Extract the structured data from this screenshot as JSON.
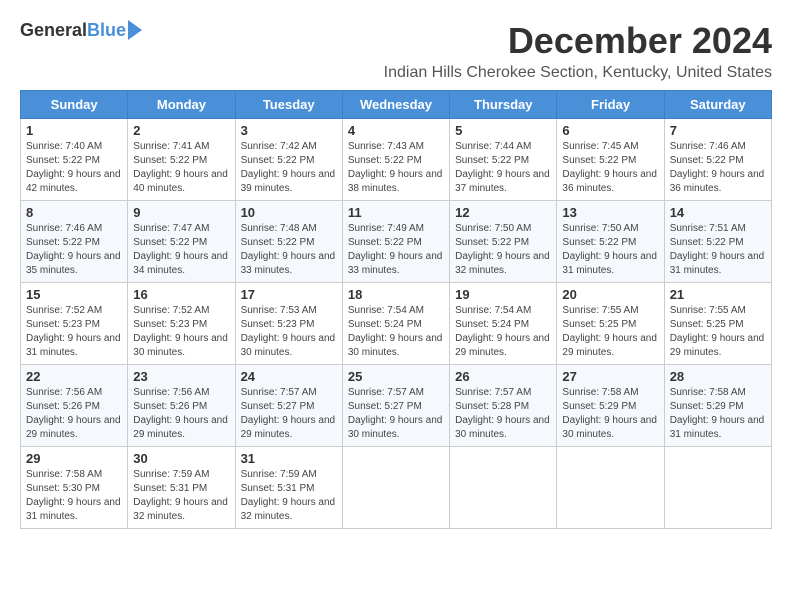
{
  "logo": {
    "general": "General",
    "blue": "Blue"
  },
  "title": "December 2024",
  "location": "Indian Hills Cherokee Section, Kentucky, United States",
  "headers": [
    "Sunday",
    "Monday",
    "Tuesday",
    "Wednesday",
    "Thursday",
    "Friday",
    "Saturday"
  ],
  "weeks": [
    [
      {
        "day": "1",
        "sunrise": "7:40 AM",
        "sunset": "5:22 PM",
        "daylight": "9 hours and 42 minutes."
      },
      {
        "day": "2",
        "sunrise": "7:41 AM",
        "sunset": "5:22 PM",
        "daylight": "9 hours and 40 minutes."
      },
      {
        "day": "3",
        "sunrise": "7:42 AM",
        "sunset": "5:22 PM",
        "daylight": "9 hours and 39 minutes."
      },
      {
        "day": "4",
        "sunrise": "7:43 AM",
        "sunset": "5:22 PM",
        "daylight": "9 hours and 38 minutes."
      },
      {
        "day": "5",
        "sunrise": "7:44 AM",
        "sunset": "5:22 PM",
        "daylight": "9 hours and 37 minutes."
      },
      {
        "day": "6",
        "sunrise": "7:45 AM",
        "sunset": "5:22 PM",
        "daylight": "9 hours and 36 minutes."
      },
      {
        "day": "7",
        "sunrise": "7:46 AM",
        "sunset": "5:22 PM",
        "daylight": "9 hours and 36 minutes."
      }
    ],
    [
      {
        "day": "8",
        "sunrise": "7:46 AM",
        "sunset": "5:22 PM",
        "daylight": "9 hours and 35 minutes."
      },
      {
        "day": "9",
        "sunrise": "7:47 AM",
        "sunset": "5:22 PM",
        "daylight": "9 hours and 34 minutes."
      },
      {
        "day": "10",
        "sunrise": "7:48 AM",
        "sunset": "5:22 PM",
        "daylight": "9 hours and 33 minutes."
      },
      {
        "day": "11",
        "sunrise": "7:49 AM",
        "sunset": "5:22 PM",
        "daylight": "9 hours and 33 minutes."
      },
      {
        "day": "12",
        "sunrise": "7:50 AM",
        "sunset": "5:22 PM",
        "daylight": "9 hours and 32 minutes."
      },
      {
        "day": "13",
        "sunrise": "7:50 AM",
        "sunset": "5:22 PM",
        "daylight": "9 hours and 31 minutes."
      },
      {
        "day": "14",
        "sunrise": "7:51 AM",
        "sunset": "5:22 PM",
        "daylight": "9 hours and 31 minutes."
      }
    ],
    [
      {
        "day": "15",
        "sunrise": "7:52 AM",
        "sunset": "5:23 PM",
        "daylight": "9 hours and 31 minutes."
      },
      {
        "day": "16",
        "sunrise": "7:52 AM",
        "sunset": "5:23 PM",
        "daylight": "9 hours and 30 minutes."
      },
      {
        "day": "17",
        "sunrise": "7:53 AM",
        "sunset": "5:23 PM",
        "daylight": "9 hours and 30 minutes."
      },
      {
        "day": "18",
        "sunrise": "7:54 AM",
        "sunset": "5:24 PM",
        "daylight": "9 hours and 30 minutes."
      },
      {
        "day": "19",
        "sunrise": "7:54 AM",
        "sunset": "5:24 PM",
        "daylight": "9 hours and 29 minutes."
      },
      {
        "day": "20",
        "sunrise": "7:55 AM",
        "sunset": "5:25 PM",
        "daylight": "9 hours and 29 minutes."
      },
      {
        "day": "21",
        "sunrise": "7:55 AM",
        "sunset": "5:25 PM",
        "daylight": "9 hours and 29 minutes."
      }
    ],
    [
      {
        "day": "22",
        "sunrise": "7:56 AM",
        "sunset": "5:26 PM",
        "daylight": "9 hours and 29 minutes."
      },
      {
        "day": "23",
        "sunrise": "7:56 AM",
        "sunset": "5:26 PM",
        "daylight": "9 hours and 29 minutes."
      },
      {
        "day": "24",
        "sunrise": "7:57 AM",
        "sunset": "5:27 PM",
        "daylight": "9 hours and 29 minutes."
      },
      {
        "day": "25",
        "sunrise": "7:57 AM",
        "sunset": "5:27 PM",
        "daylight": "9 hours and 30 minutes."
      },
      {
        "day": "26",
        "sunrise": "7:57 AM",
        "sunset": "5:28 PM",
        "daylight": "9 hours and 30 minutes."
      },
      {
        "day": "27",
        "sunrise": "7:58 AM",
        "sunset": "5:29 PM",
        "daylight": "9 hours and 30 minutes."
      },
      {
        "day": "28",
        "sunrise": "7:58 AM",
        "sunset": "5:29 PM",
        "daylight": "9 hours and 31 minutes."
      }
    ],
    [
      {
        "day": "29",
        "sunrise": "7:58 AM",
        "sunset": "5:30 PM",
        "daylight": "9 hours and 31 minutes."
      },
      {
        "day": "30",
        "sunrise": "7:59 AM",
        "sunset": "5:31 PM",
        "daylight": "9 hours and 32 minutes."
      },
      {
        "day": "31",
        "sunrise": "7:59 AM",
        "sunset": "5:31 PM",
        "daylight": "9 hours and 32 minutes."
      },
      null,
      null,
      null,
      null
    ]
  ]
}
